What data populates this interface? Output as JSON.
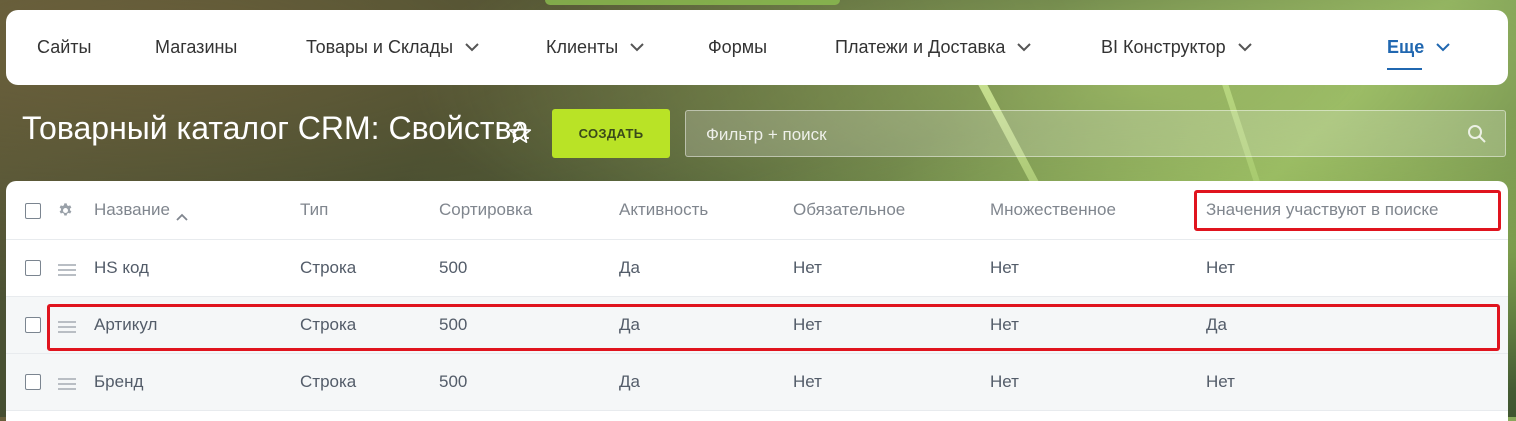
{
  "nav": {
    "items": [
      {
        "label": "Сайты"
      },
      {
        "label": "Магазины"
      },
      {
        "label": "Товары и Склады"
      },
      {
        "label": "Клиенты"
      },
      {
        "label": "Формы"
      },
      {
        "label": "Платежи и Доставка"
      },
      {
        "label": "BI Конструктор"
      },
      {
        "label": "Еще"
      }
    ]
  },
  "page": {
    "title": "Товарный каталог CRM: Свойства",
    "create_label": "СОЗДАТЬ",
    "filter_placeholder": "Фильтр + поиск"
  },
  "table": {
    "columns": [
      "Название",
      "Тип",
      "Сортировка",
      "Активность",
      "Обязательное",
      "Множественное",
      "Значения участвуют в поиске"
    ],
    "sorted_column": "Название",
    "rows": [
      {
        "name": "HS код",
        "type": "Строка",
        "sort": "500",
        "active": "Да",
        "required": "Нет",
        "multiple": "Нет",
        "searchable": "Нет"
      },
      {
        "name": "Артикул",
        "type": "Строка",
        "sort": "500",
        "active": "Да",
        "required": "Нет",
        "multiple": "Нет",
        "searchable": "Да"
      },
      {
        "name": "Бренд",
        "type": "Строка",
        "sort": "500",
        "active": "Да",
        "required": "Нет",
        "multiple": "Нет",
        "searchable": "Нет"
      }
    ]
  },
  "colors": {
    "accent": "#2067b0",
    "create_button": "#b9e326",
    "highlight": "#e0141e"
  }
}
